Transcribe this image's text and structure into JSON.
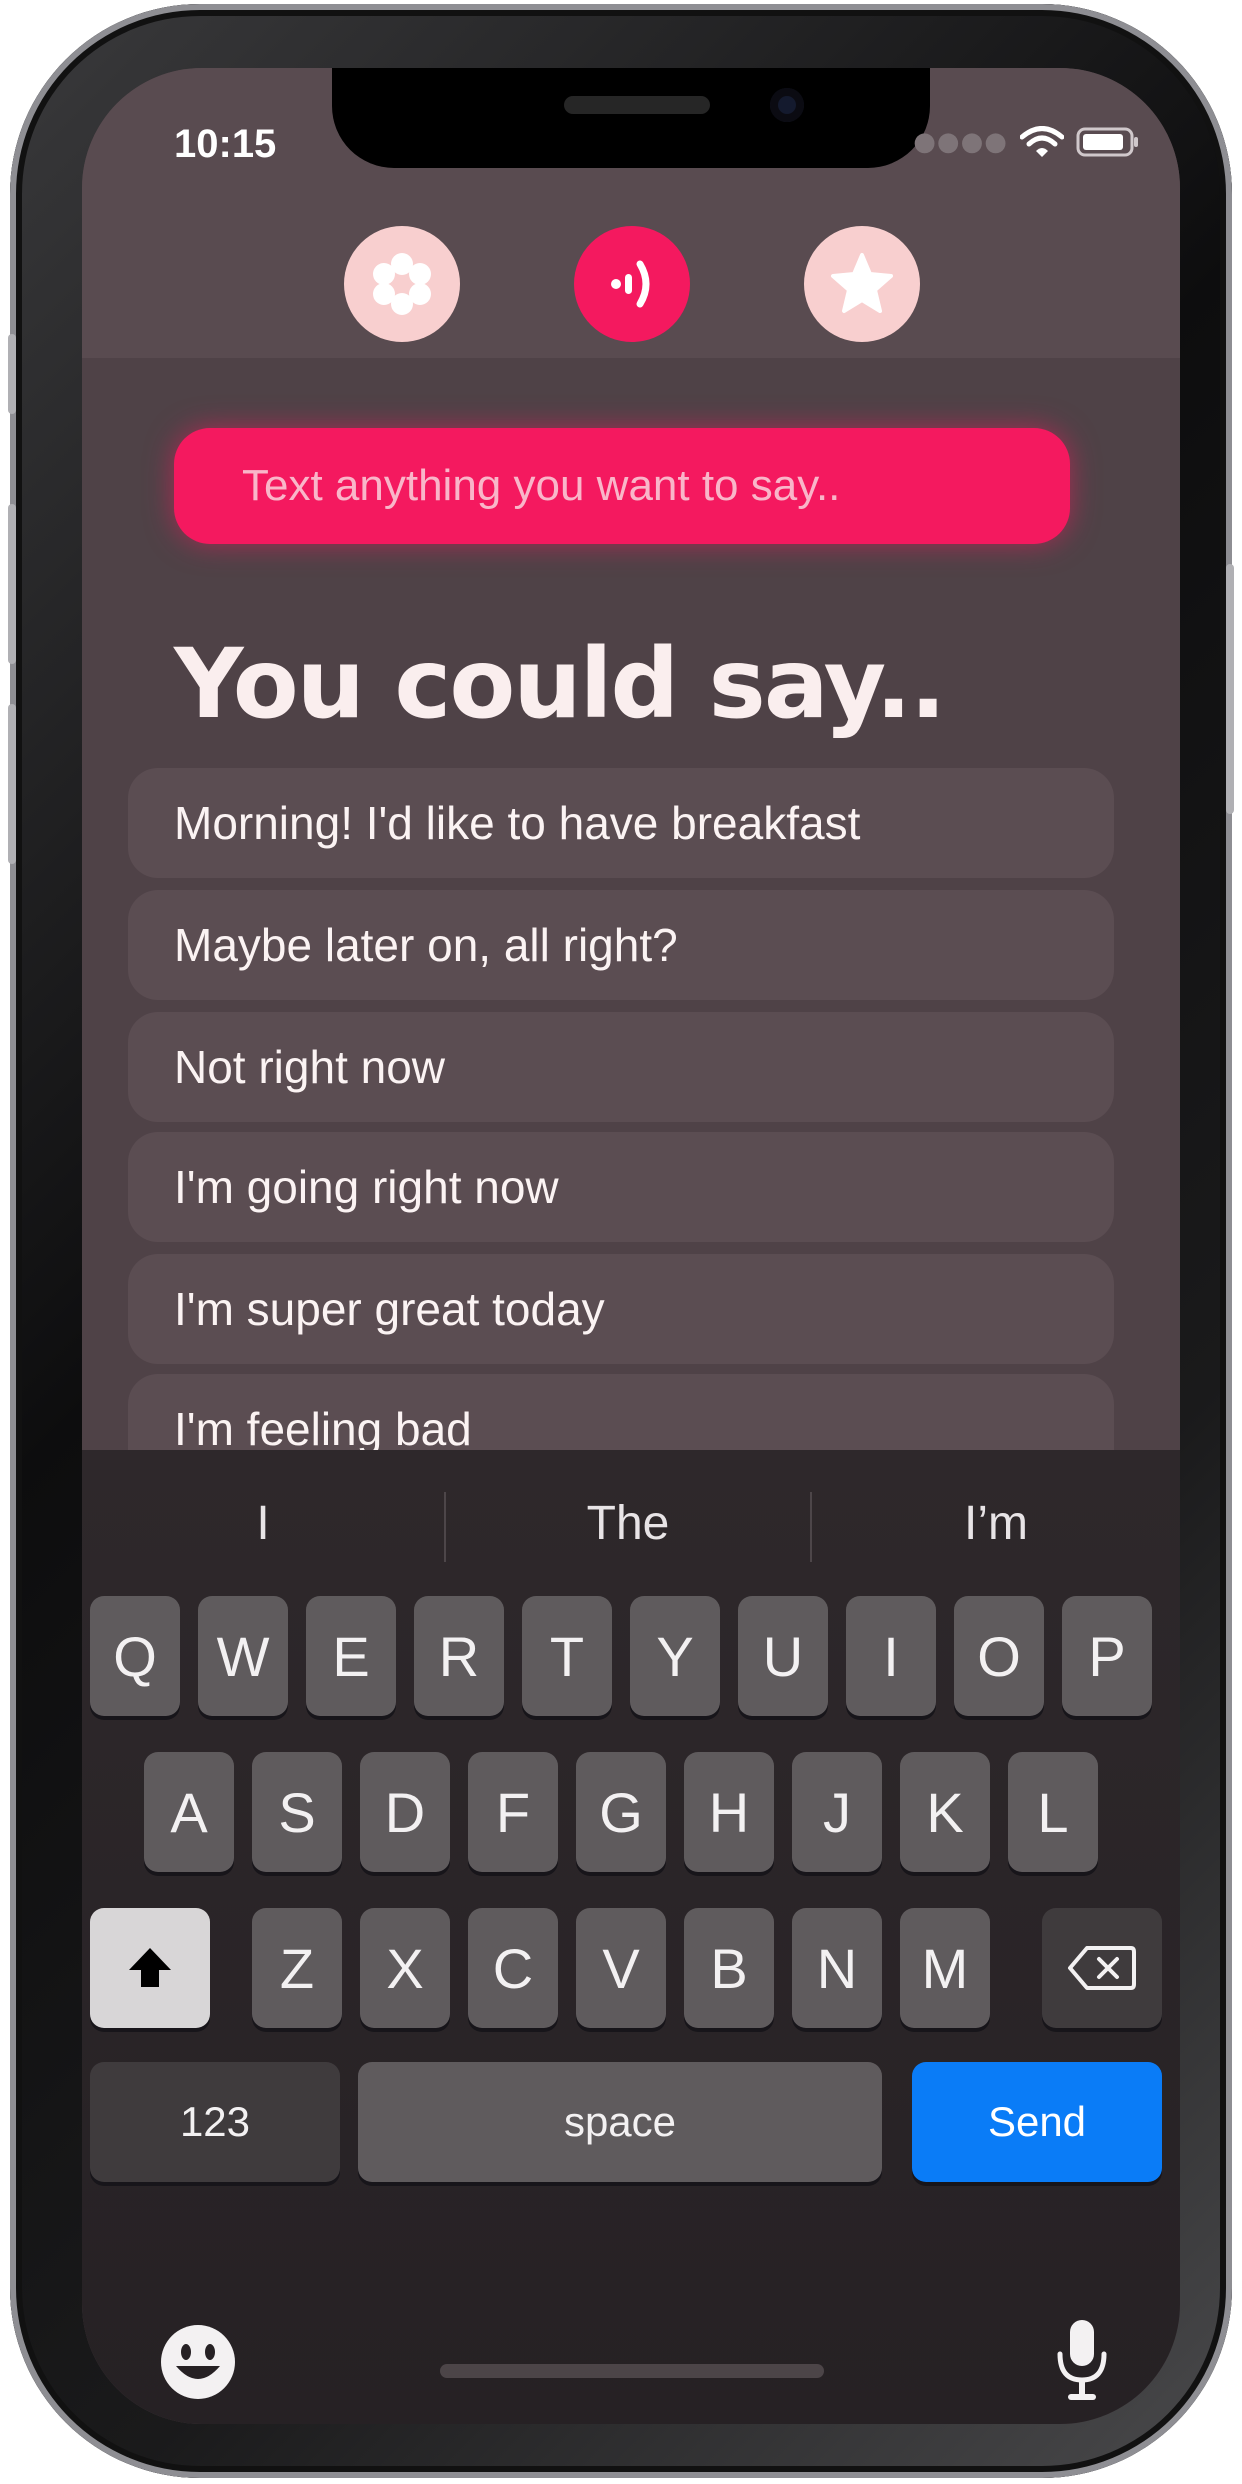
{
  "status": {
    "time": "10:15",
    "icons": [
      "signal-dots-icon",
      "wifi-icon",
      "battery-icon"
    ]
  },
  "nav": {
    "buttons": [
      {
        "name": "flower",
        "icon": "flower-icon",
        "style": "soft"
      },
      {
        "name": "speak",
        "icon": "speaking-icon",
        "style": "accent"
      },
      {
        "name": "favorites",
        "icon": "star-icon",
        "style": "soft"
      }
    ]
  },
  "input": {
    "placeholder": "Text anything you want to say.."
  },
  "heading": "You could say..",
  "phrases": [
    "Morning! I'd like to have breakfast",
    "Maybe later on, all right?",
    "Not right now",
    "I'm going right now",
    "I'm super great today",
    "I'm feeling bad"
  ],
  "keyboard": {
    "suggestions": [
      "I",
      "The",
      "I’m"
    ],
    "row1": [
      "Q",
      "W",
      "E",
      "R",
      "T",
      "Y",
      "U",
      "I",
      "O",
      "P"
    ],
    "row2": [
      "A",
      "S",
      "D",
      "F",
      "G",
      "H",
      "J",
      "K",
      "L"
    ],
    "row3": [
      "Z",
      "X",
      "C",
      "V",
      "B",
      "N",
      "M"
    ],
    "numbers_label": "123",
    "space_label": "space",
    "send_label": "Send"
  },
  "colors": {
    "accent": "#f4195f",
    "soft": "#f8cfcf",
    "background": "#4f4247",
    "send": "#0a7cf7"
  }
}
